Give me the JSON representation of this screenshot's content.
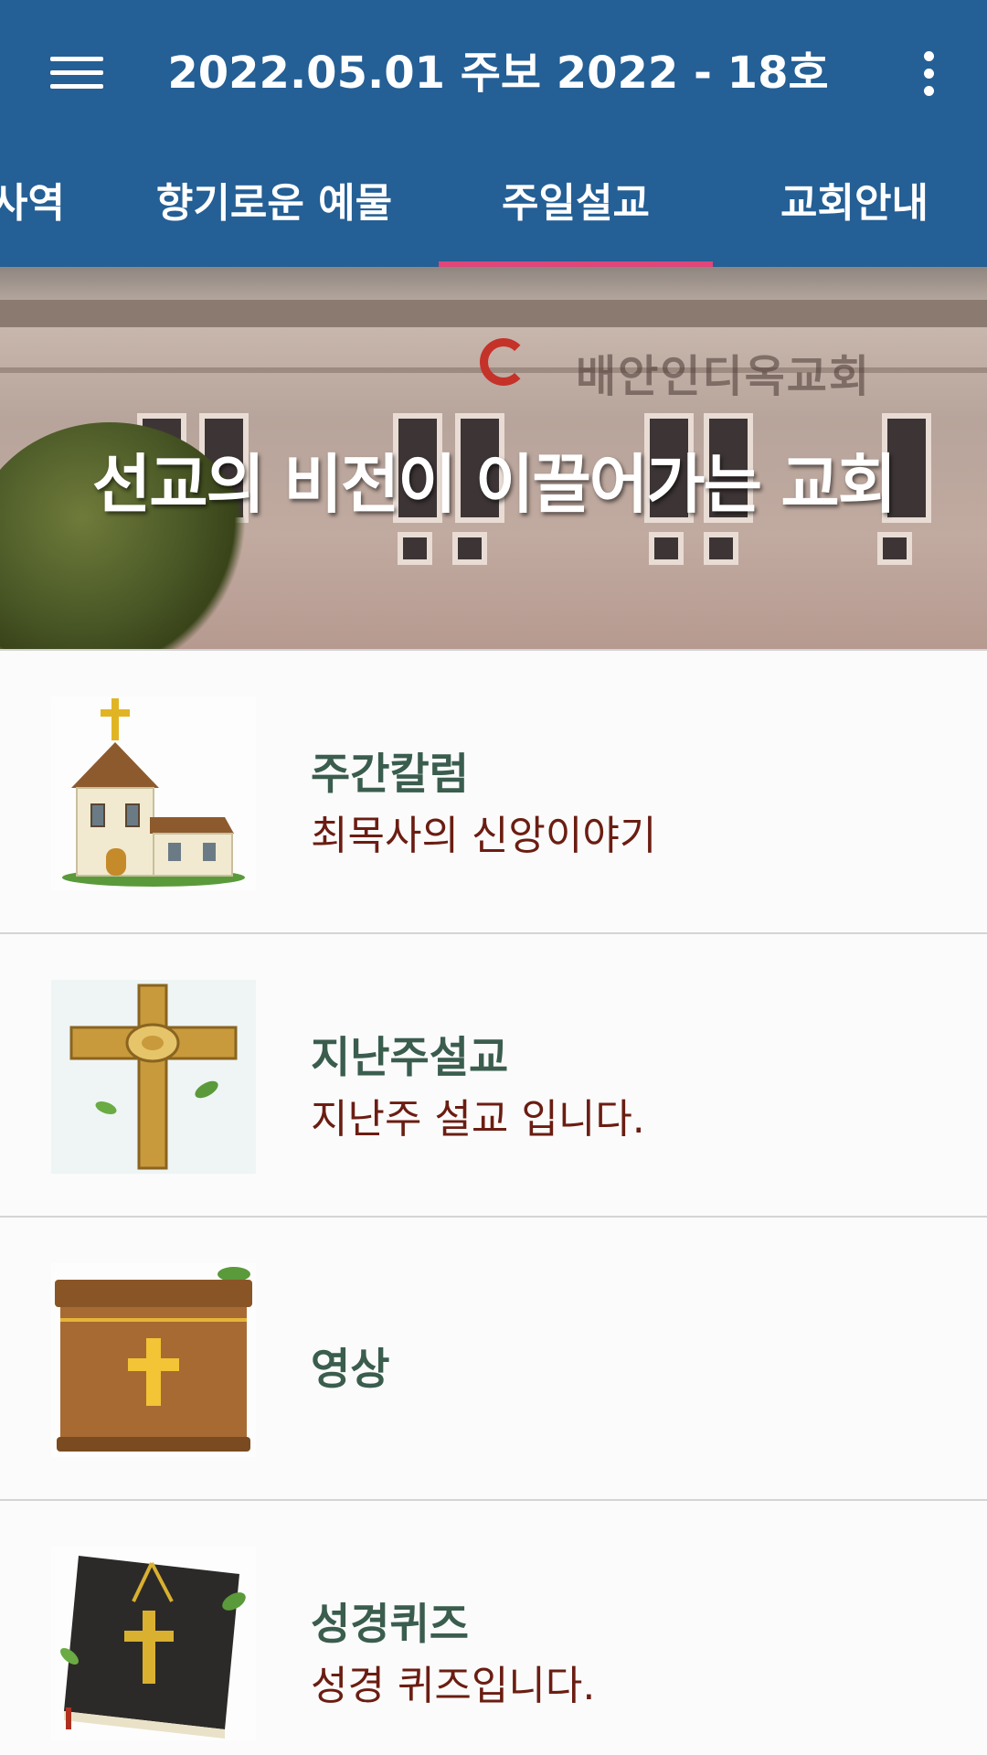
{
  "app": {
    "title": "2022.05.01 주보 2022 - 18호"
  },
  "tabs": [
    {
      "label": "사역",
      "selected": false
    },
    {
      "label": "향기로운 예물",
      "selected": false
    },
    {
      "label": "주일설교",
      "selected": true
    },
    {
      "label": "교회안내",
      "selected": false
    }
  ],
  "banner": {
    "slogan": "선교의 비전이 이끌어가는 교회",
    "sign": "배안인디옥교회"
  },
  "items": [
    {
      "title": "주간칼럼",
      "subtitle": "최목사의 신앙이야기",
      "icon": "church-icon"
    },
    {
      "title": "지난주설교",
      "subtitle": "지난주 설교 입니다.",
      "icon": "cross-icon"
    },
    {
      "title": "영상",
      "subtitle": "",
      "icon": "pulpit-icon"
    },
    {
      "title": "성경퀴즈",
      "subtitle": "성경 퀴즈입니다.",
      "icon": "bible-icon"
    }
  ],
  "colors": {
    "appbar": "#245f95",
    "tab_indicator": "#e0467a",
    "item_title": "#3a5d4e",
    "item_subtitle": "#6b1d12"
  }
}
